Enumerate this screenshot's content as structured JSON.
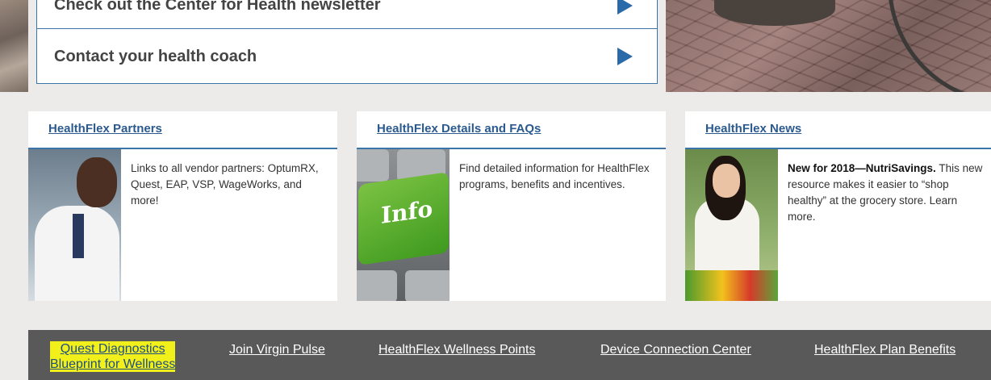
{
  "top_links": [
    {
      "label": "Check out the Center for Health newsletter"
    },
    {
      "label": "Contact your health coach"
    }
  ],
  "cards": [
    {
      "title": "HealthFlex Partners",
      "image": "doctor-photo",
      "text": "Links to all vendor partners: OptumRX, Quest, EAP, VSP, WageWorks, and more!"
    },
    {
      "title": "HealthFlex Details and FAQs",
      "image": "info-key-photo",
      "image_text": "Info",
      "text": "Find detailed information for HealthFlex programs, benefits and incentives."
    },
    {
      "title": "HealthFlex News",
      "image": "woman-grocery-photo",
      "text_bold": "New for 2018—NutriSavings.",
      "text": "This new resource makes it easier to “shop healthy” at the grocery store. Learn more."
    }
  ],
  "footer": {
    "links": [
      {
        "line1": "Quest Diagnostics",
        "line2": "Blueprint for Wellness",
        "highlighted": true
      },
      {
        "label": "Join Virgin Pulse"
      },
      {
        "label": "HealthFlex Wellness Points"
      },
      {
        "label": "Device Connection Center"
      },
      {
        "label": "HealthFlex Plan Benefits"
      }
    ]
  },
  "colors": {
    "accent": "#2a6aa9",
    "link": "#2b5a8f",
    "footer_bg": "#595959",
    "highlight": "#f1f01a"
  }
}
